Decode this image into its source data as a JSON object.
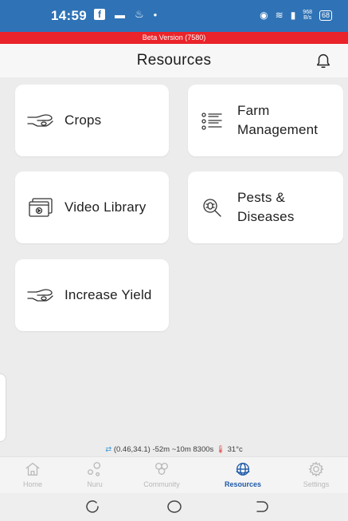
{
  "status_bar": {
    "time": "14:59",
    "fb_icon": "facebook-icon",
    "net_speed_value": "968",
    "net_speed_unit": "B/s",
    "battery": "68"
  },
  "beta_banner": "Beta Version (7580)",
  "header": {
    "title": "Resources"
  },
  "cards": [
    {
      "label_lines": [
        "Crops"
      ],
      "icon": "hand-seed-icon"
    },
    {
      "label_lines": [
        "Farm",
        "Management"
      ],
      "icon": "checklist-icon"
    },
    {
      "label_lines": [
        "Video Library"
      ],
      "icon": "video-library-icon"
    },
    {
      "label_lines": [
        "Pests &",
        "Diseases"
      ],
      "icon": "magnifier-bug-icon"
    },
    {
      "label_lines": [
        "Increase Yield"
      ],
      "icon": "hand-seed-icon"
    }
  ],
  "location": {
    "coords": "(0.46,34.1)",
    "details": "-52m ~10m 8300s",
    "temperature": "31°c"
  },
  "bottom_nav": [
    {
      "label": "Home",
      "active": false
    },
    {
      "label": "Nuru",
      "active": false
    },
    {
      "label": "Community",
      "active": false
    },
    {
      "label": "Resources",
      "active": true
    },
    {
      "label": "Settings",
      "active": false
    }
  ],
  "colors": {
    "status_bar": "#2f73b6",
    "beta_banner": "#e9242a",
    "active_nav": "#1e5aa8",
    "background": "#ececec"
  }
}
